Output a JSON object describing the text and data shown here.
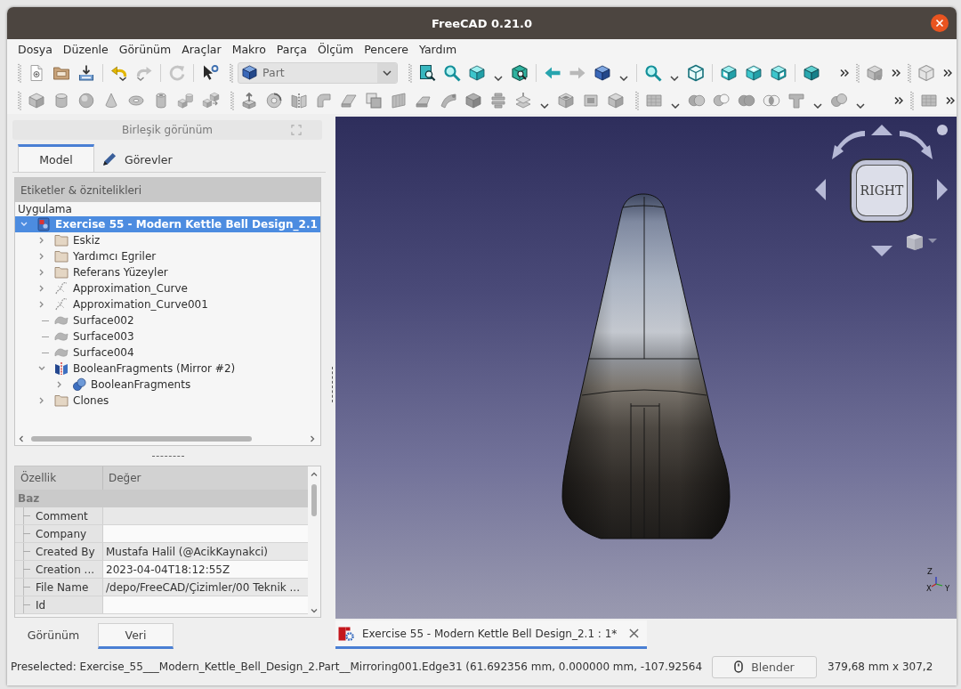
{
  "window": {
    "title": "FreeCAD 0.21.0"
  },
  "menu_bar": [
    "Dosya",
    "Düzenle",
    "Görünüm",
    "Araçlar",
    "Makro",
    "Parça",
    "Ölçüm",
    "Pencere",
    "Yardım"
  ],
  "toolbar": {
    "workbench": "Part"
  },
  "combo_view": {
    "title": "Birleşik görünüm",
    "tabs": [
      {
        "label": "Model",
        "selected": true
      },
      {
        "label": "Görevler",
        "selected": false
      }
    ],
    "tree": {
      "header": "Etiketler & öznitelikleri",
      "root_label": "Uygulama",
      "items": [
        {
          "label": "Exercise 55 - Modern Kettle Bell Design_2.1",
          "kind": "document",
          "expanded": true,
          "selected": true,
          "children": [
            {
              "label": "Eskiz",
              "kind": "folder",
              "expanded": false,
              "selected": false
            },
            {
              "label": "Yardımcı Egriler",
              "kind": "folder",
              "expanded": false,
              "selected": false
            },
            {
              "label": "Referans Yüzeyler",
              "kind": "folder",
              "expanded": false,
              "selected": false
            },
            {
              "label": "Approximation_Curve",
              "kind": "curve",
              "expanded": false,
              "selected": false
            },
            {
              "label": "Approximation_Curve001",
              "kind": "curve",
              "expanded": false,
              "selected": false
            },
            {
              "label": "Surface002",
              "kind": "surface",
              "selected": false
            },
            {
              "label": "Surface003",
              "kind": "surface",
              "selected": false
            },
            {
              "label": "Surface004",
              "kind": "surface",
              "selected": false
            },
            {
              "label": "BooleanFragments (Mirror #2)",
              "kind": "mirror",
              "expanded": true,
              "selected": false,
              "children": [
                {
                  "label": "BooleanFragments",
                  "kind": "boolean",
                  "expanded": false,
                  "selected": false
                }
              ]
            },
            {
              "label": "Clones",
              "kind": "folder",
              "expanded": false,
              "selected": false
            }
          ]
        }
      ]
    },
    "properties": {
      "columns": [
        "Özellik",
        "Değer"
      ],
      "groups": [
        {
          "label": "Baz",
          "rows": [
            {
              "property": "Comment"
            },
            {
              "property": "Company"
            },
            {
              "property": "Created By",
              "value": "Mustafa Halil (@AcikKaynakci)"
            },
            {
              "property": "Creation ...",
              "value": "2023-04-04T18:12:55Z"
            },
            {
              "property": "File Name",
              "value": "/depo/FreeCAD/Çizimler/00 Teknik ..."
            },
            {
              "property": "Id"
            }
          ]
        }
      ]
    },
    "bottom_tabs": [
      {
        "label": "Görünüm",
        "selected": false
      },
      {
        "label": "Veri",
        "selected": true
      }
    ]
  },
  "viewport": {
    "nav_cube": {
      "face": "RIGHT"
    },
    "axis_labels": [
      "Z",
      "X",
      "Y"
    ]
  },
  "document_tabs": [
    {
      "label": "Exercise 55 - Modern Kettle Bell Design_2.1 : 1*",
      "selected": true
    }
  ],
  "status_bar": {
    "message": "Preselected: Exercise_55___Modern_Kettle_Bell_Design_2.Part__Mirroring001.Edge31 (61.692356 mm, 0.000000 mm, -107.92564",
    "navigation_style": "Blender",
    "dimensions": "379,68 mm x 307,2"
  }
}
